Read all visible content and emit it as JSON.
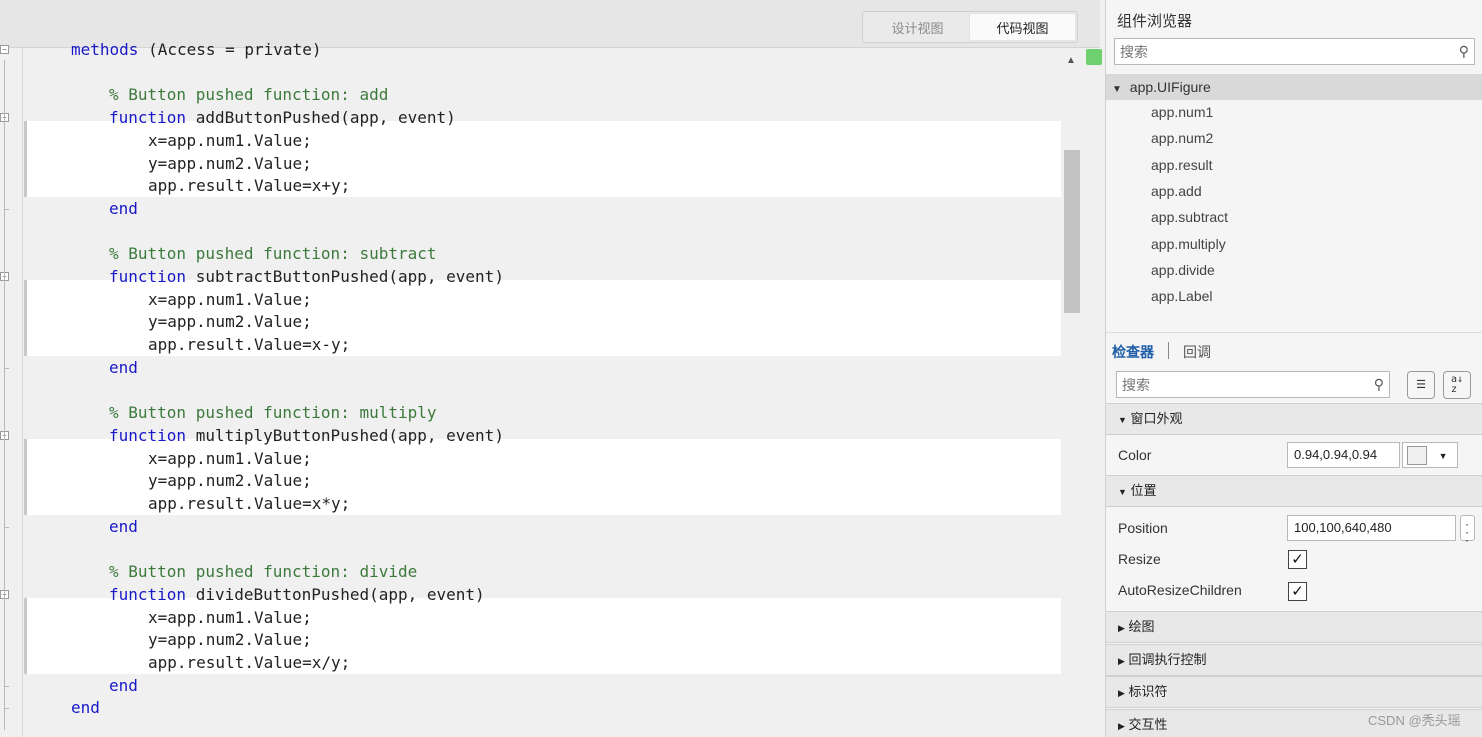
{
  "view_toggle": {
    "design": "设计视图",
    "code": "代码视图"
  },
  "code_lines": [
    {
      "indent": 1,
      "tokens": [
        {
          "t": "methods",
          "c": "kw"
        },
        {
          "t": " (Access = private)",
          "c": ""
        }
      ]
    },
    {
      "indent": 0,
      "tokens": []
    },
    {
      "indent": 2,
      "tokens": [
        {
          "t": "% Button pushed function: add",
          "c": "cm"
        }
      ]
    },
    {
      "indent": 2,
      "tokens": [
        {
          "t": "function",
          "c": "kw"
        },
        {
          "t": " addButtonPushed(app, event)",
          "c": ""
        }
      ]
    },
    {
      "indent": 3,
      "tokens": [
        {
          "t": "x=app.num1.Value;",
          "c": ""
        }
      ]
    },
    {
      "indent": 3,
      "tokens": [
        {
          "t": "y=app.num2.Value;",
          "c": ""
        }
      ]
    },
    {
      "indent": 3,
      "tokens": [
        {
          "t": "app.result.Value=x+y;",
          "c": ""
        }
      ]
    },
    {
      "indent": 2,
      "tokens": [
        {
          "t": "end",
          "c": "kw"
        }
      ]
    },
    {
      "indent": 0,
      "tokens": []
    },
    {
      "indent": 2,
      "tokens": [
        {
          "t": "% Button pushed function: subtract",
          "c": "cm"
        }
      ]
    },
    {
      "indent": 2,
      "tokens": [
        {
          "t": "function",
          "c": "kw"
        },
        {
          "t": " subtractButtonPushed(app, event)",
          "c": ""
        }
      ]
    },
    {
      "indent": 3,
      "tokens": [
        {
          "t": "x=app.num1.Value;",
          "c": ""
        }
      ]
    },
    {
      "indent": 3,
      "tokens": [
        {
          "t": "y=app.num2.Value;",
          "c": ""
        }
      ]
    },
    {
      "indent": 3,
      "tokens": [
        {
          "t": "app.result.Value=x-y;",
          "c": ""
        }
      ]
    },
    {
      "indent": 2,
      "tokens": [
        {
          "t": "end",
          "c": "kw"
        }
      ]
    },
    {
      "indent": 0,
      "tokens": []
    },
    {
      "indent": 2,
      "tokens": [
        {
          "t": "% Button pushed function: multiply",
          "c": "cm"
        }
      ]
    },
    {
      "indent": 2,
      "tokens": [
        {
          "t": "function",
          "c": "kw"
        },
        {
          "t": " multiplyButtonPushed(app, event)",
          "c": ""
        }
      ]
    },
    {
      "indent": 3,
      "tokens": [
        {
          "t": "x=app.num1.Value;",
          "c": ""
        }
      ]
    },
    {
      "indent": 3,
      "tokens": [
        {
          "t": "y=app.num2.Value;",
          "c": ""
        }
      ]
    },
    {
      "indent": 3,
      "tokens": [
        {
          "t": "app.result.Value=x*y;",
          "c": ""
        }
      ]
    },
    {
      "indent": 2,
      "tokens": [
        {
          "t": "end",
          "c": "kw"
        }
      ]
    },
    {
      "indent": 0,
      "tokens": []
    },
    {
      "indent": 2,
      "tokens": [
        {
          "t": "% Button pushed function: divide",
          "c": "cm"
        }
      ]
    },
    {
      "indent": 2,
      "tokens": [
        {
          "t": "function",
          "c": "kw"
        },
        {
          "t": " divideButtonPushed(app, event)",
          "c": ""
        }
      ]
    },
    {
      "indent": 3,
      "tokens": [
        {
          "t": "x=app.num1.Value;",
          "c": ""
        }
      ]
    },
    {
      "indent": 3,
      "tokens": [
        {
          "t": "y=app.num2.Value;",
          "c": ""
        }
      ]
    },
    {
      "indent": 3,
      "tokens": [
        {
          "t": "app.result.Value=x/y;",
          "c": ""
        }
      ]
    },
    {
      "indent": 2,
      "tokens": [
        {
          "t": "end",
          "c": "kw"
        }
      ]
    },
    {
      "indent": 1,
      "tokens": [
        {
          "t": "end",
          "c": "kw"
        }
      ]
    }
  ],
  "component_browser": {
    "title": "组件浏览器",
    "search_placeholder": "搜索",
    "root": "app.UIFigure",
    "items": [
      "app.num1",
      "app.num2",
      "app.result",
      "app.add",
      "app.subtract",
      "app.multiply",
      "app.divide",
      "app.Label"
    ]
  },
  "inspector": {
    "tab_inspector": "检查器",
    "tab_callback": "回调",
    "search_placeholder": "搜索",
    "sections": {
      "appearance": "窗口外观",
      "position": "位置",
      "plotting": "绘图",
      "callback_exec": "回调执行控制",
      "identifier": "标识符",
      "interactivity": "交互性"
    },
    "props": {
      "color_label": "Color",
      "color_value": "0.94,0.94,0.94",
      "color_swatch": "#f0f0f0",
      "position_label": "Position",
      "position_value": "100,100,640,480",
      "resize_label": "Resize",
      "resize_checked": true,
      "autoresize_label": "AutoResizeChildren",
      "autoresize_checked": true
    }
  },
  "watermark": "CSDN @秃头瑶",
  "colors": {
    "keyword": "#1818c8",
    "comment": "#3c7a3c",
    "active_tab": "#1f5ea8",
    "status_ok": "#6fd06f"
  }
}
